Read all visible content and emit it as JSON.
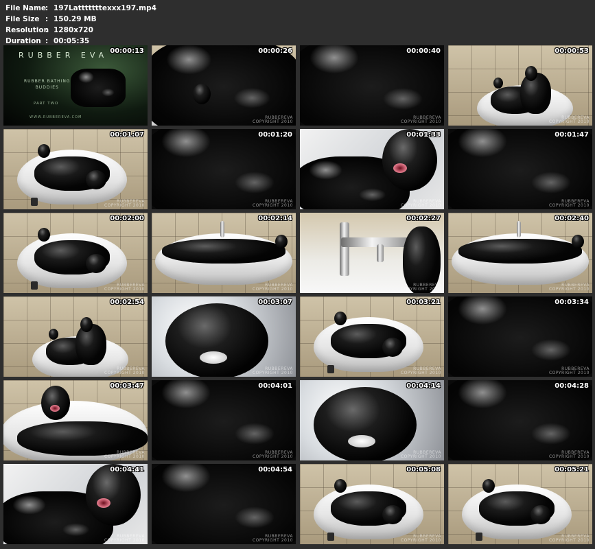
{
  "info": {
    "file_name_label": "File Name",
    "file_name": "197Latttttttexxx197.mp4",
    "file_size_label": "File Size",
    "file_size": "150.29 MB",
    "resolution_label": "Resolution",
    "resolution": "1280x720",
    "duration_label": "Duration",
    "duration": "00:05:35",
    "separator": ":"
  },
  "intro": {
    "title": "RUBBER EVA",
    "subtitle_line1": "RUBBER BATHING",
    "subtitle_line2": "BUDDIES",
    "part": "PART TWO",
    "url": "WWW.RUBBEREVA.COM"
  },
  "watermark": {
    "line1": "RUBBEREVA",
    "line2": "COPYRIGHT 2010"
  },
  "thumbnails": [
    {
      "timestamp": "00:00:13",
      "scene": "intro"
    },
    {
      "timestamp": "00:00:26",
      "scene": "closeup-tub"
    },
    {
      "timestamp": "00:00:40",
      "scene": "closeup-latex"
    },
    {
      "timestamp": "00:00:53",
      "scene": "tub-two"
    },
    {
      "timestamp": "00:01:07",
      "scene": "tub-wide"
    },
    {
      "timestamp": "00:01:20",
      "scene": "closeup-latex"
    },
    {
      "timestamp": "00:01:33",
      "scene": "mask-closeup"
    },
    {
      "timestamp": "00:01:47",
      "scene": "closeup-latex"
    },
    {
      "timestamp": "00:02:00",
      "scene": "tub-wide"
    },
    {
      "timestamp": "00:02:14",
      "scene": "tub-side"
    },
    {
      "timestamp": "00:02:27",
      "scene": "tap"
    },
    {
      "timestamp": "00:02:40",
      "scene": "tub-side"
    },
    {
      "timestamp": "00:02:54",
      "scene": "tub-two"
    },
    {
      "timestamp": "00:03:07",
      "scene": "snow-mask"
    },
    {
      "timestamp": "00:03:21",
      "scene": "tub-wide"
    },
    {
      "timestamp": "00:03:34",
      "scene": "closeup-latex"
    },
    {
      "timestamp": "00:03:47",
      "scene": "tub-head"
    },
    {
      "timestamp": "00:04:01",
      "scene": "closeup-latex"
    },
    {
      "timestamp": "00:04:14",
      "scene": "snow-mask"
    },
    {
      "timestamp": "00:04:28",
      "scene": "closeup-latex"
    },
    {
      "timestamp": "00:04:41",
      "scene": "mask-closeup"
    },
    {
      "timestamp": "00:04:54",
      "scene": "closeup-latex"
    },
    {
      "timestamp": "00:05:08",
      "scene": "tub-wide"
    },
    {
      "timestamp": "00:05:21",
      "scene": "tub-wide"
    }
  ]
}
